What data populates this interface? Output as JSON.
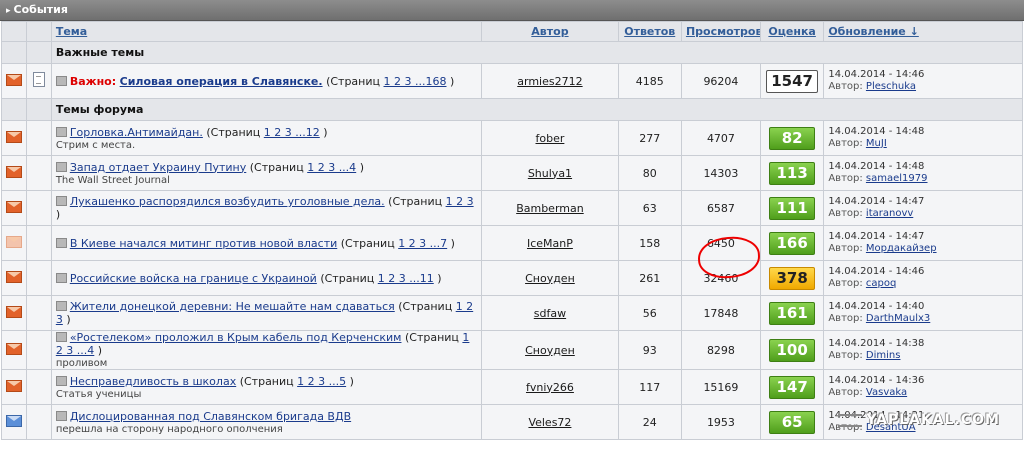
{
  "section_title": "События",
  "columns": {
    "topic": "Тема",
    "author": "Автор",
    "replies": "Ответов",
    "views": "Просмотров",
    "rating": "Оценка",
    "update": "Обновление ↓"
  },
  "sections": {
    "important": "Важные темы",
    "forum": "Темы форума"
  },
  "pinned": {
    "prefix": "Важно:",
    "title": "Силовая операция в Славянске.",
    "pages_open": "(Страниц",
    "pages": "1 2 3 ...168",
    "pages_close": ")",
    "author": "armies2712",
    "replies": "4185",
    "views": "96204",
    "rating": "1547",
    "date": "14.04.2014 - 14:46",
    "last_author": "Pleschuka"
  },
  "author_label": "Автор:",
  "topics": [
    {
      "title": "Горловка.Антимайдан.",
      "pages": "1 2 3 ...12",
      "sub": "Стрим с места.",
      "author": "fober",
      "replies": "277",
      "views": "4707",
      "rating": "82",
      "rating_color": "green",
      "date": "14.04.2014 - 14:48",
      "last_author": "MuJI",
      "icon": "orange"
    },
    {
      "title": "Запад отдает Украину Путину",
      "pages": "1 2 3 ...4",
      "sub": "The Wall Street Journal",
      "author": "Shulya1",
      "replies": "80",
      "views": "14303",
      "rating": "113",
      "rating_color": "green",
      "date": "14.04.2014 - 14:48",
      "last_author": "samael1979",
      "icon": "orange"
    },
    {
      "title": "Лукашенко распорядился возбудить уголовные дела.",
      "pages": "1 2 3",
      "sub": "",
      "author": "Bamberman",
      "replies": "63",
      "views": "6587",
      "rating": "111",
      "rating_color": "green",
      "date": "14.04.2014 - 14:47",
      "last_author": "itaranovv",
      "icon": "orange"
    },
    {
      "title": "В Киеве начался митинг против новой власти",
      "pages": "1 2 3 ...7",
      "sub": "",
      "author": "IceManP",
      "replies": "158",
      "views": "6450",
      "rating": "166",
      "rating_color": "green",
      "date": "14.04.2014 - 14:47",
      "last_author": "Мордакайзер",
      "icon": "faded"
    },
    {
      "title": "Российские войска на границе с Украиной",
      "pages": "1 2 3 ...11",
      "sub": "",
      "author": "Сноуден",
      "replies": "261",
      "views": "32460",
      "rating": "378",
      "rating_color": "yellow",
      "date": "14.04.2014 - 14:46",
      "last_author": "capoq",
      "icon": "orange"
    },
    {
      "title": "Жители донецкой деревни: Не мешайте нам сдаваться",
      "pages": "1 2 3",
      "sub": "",
      "author": "sdfaw",
      "replies": "56",
      "views": "17848",
      "rating": "161",
      "rating_color": "green",
      "date": "14.04.2014 - 14:40",
      "last_author": "DarthMaulx3",
      "icon": "orange"
    },
    {
      "title": "«Ростелеком» проложил в Крым кабель под Керченским",
      "pages": "1 2 3 ...4",
      "sub": "проливом",
      "author": "Сноуден",
      "replies": "93",
      "views": "8298",
      "rating": "100",
      "rating_color": "green",
      "date": "14.04.2014 - 14:38",
      "last_author": "Dimins",
      "icon": "orange"
    },
    {
      "title": "Несправедливость в школах",
      "pages": "1 2 3 ...5",
      "sub": "Статья ученицы",
      "author": "fvniy266",
      "replies": "117",
      "views": "15169",
      "rating": "147",
      "rating_color": "green",
      "date": "14.04.2014 - 14:36",
      "last_author": "Vasvaka",
      "icon": "orange"
    },
    {
      "title": "Дислоцированная под Славянском бригада ВДВ",
      "pages": "",
      "sub": "перешла на сторону народного ополчения",
      "author": "Veles72",
      "replies": "24",
      "views": "1953",
      "rating": "65",
      "rating_color": "green",
      "date": "14.04.2014 - 14:21",
      "last_author": "DesantUA",
      "icon": "blue"
    }
  ],
  "pages_open": "(Страниц",
  "pages_close": ")",
  "watermark": "YAPLAKAL.COM"
}
